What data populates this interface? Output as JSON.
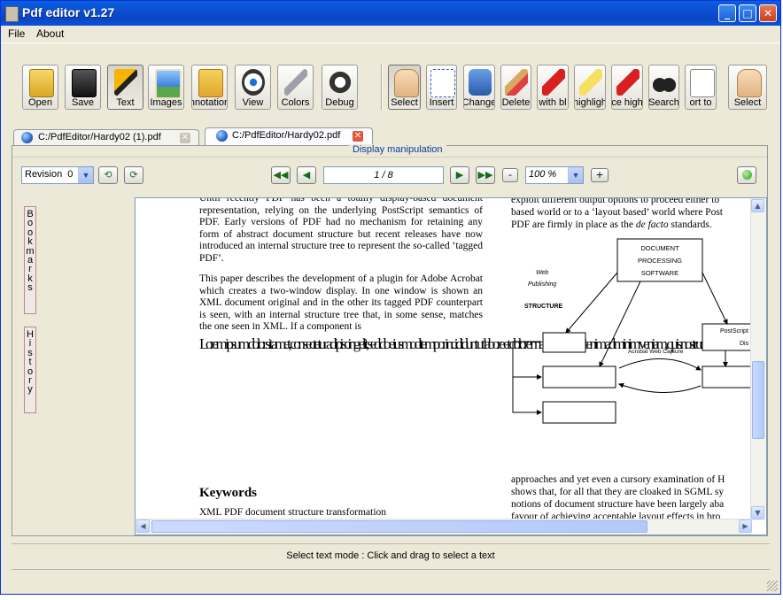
{
  "window": {
    "title": "Pdf editor v1.27"
  },
  "menu": [
    "File",
    "About"
  ],
  "toolbar": {
    "left": [
      {
        "label": "Open",
        "icon": "folder-icon"
      },
      {
        "label": "Save",
        "icon": "floppy-disk-icon"
      },
      {
        "label": "Text",
        "icon": "marker-pen-icon"
      },
      {
        "label": "Images",
        "icon": "picture-icon"
      },
      {
        "label": "nnotation",
        "icon": "sticky-note-icon"
      },
      {
        "label": "View",
        "icon": "eye-icon"
      },
      {
        "label": "Colors",
        "icon": "wrench-icon"
      },
      {
        "label": "Debug",
        "icon": "bug-icon"
      }
    ],
    "right": [
      {
        "label": "Select",
        "icon": "hand-icon"
      },
      {
        "label": "Insert",
        "icon": "insert-text-icon"
      },
      {
        "label": "Change",
        "icon": "paint-bucket-icon"
      },
      {
        "label": "Delete",
        "icon": "broom-delete-icon"
      },
      {
        "label": "with bl",
        "icon": "red-marker-icon"
      },
      {
        "label": "highligh",
        "icon": "highlighter-icon"
      },
      {
        "label": "ce high",
        "icon": "red-marker-icon"
      },
      {
        "label": "Search",
        "icon": "binoculars-icon"
      },
      {
        "label": "ort to",
        "icon": "export-icon"
      },
      {
        "label": "Select",
        "icon": "hand-icon"
      }
    ]
  },
  "tabs": [
    {
      "label": "C:/PdfEditor/Hardy02 (1).pdf",
      "active": false
    },
    {
      "label": "C:/PdfEditor/Hardy02.pdf",
      "active": true
    }
  ],
  "display": {
    "section_title": "Display manipulation",
    "revision": "Revision  0",
    "page": "1 / 8",
    "zoom": "100 %",
    "minus": "-",
    "plus": "+"
  },
  "sidebar": {
    "bookmarks": "Bookmarks",
    "history": "History"
  },
  "document": {
    "left_p1": "Until recently PDF has been a totally display-based document representation, relying on the underlying PostScript semantics of PDF. Early versions of PDF had no mechanism for retaining any form of abstract document structure but recent releases have now introduced an internal structure tree to represent the so-called ‘tagged PDF’.",
    "left_p2": "This paper describes the development of a plugin for Adobe Acrobat which creates a two-window display. In one window is shown an XML document original and in the other its tagged PDF counterpart is seen, with an internal structure tree that, in some sense, matches the one seen in XML. If a component is",
    "overlay": "Lorem ipsum dolor sit amet, consectetur adipiscing elit, sed do eiusmod tempor incididunt ut labore et dolore magna aliqua. Ut enim ad minim veniam, quis nostrud exercitation ullamco",
    "right_top_l1": "exploit different output options to proceed either to",
    "right_top_l2": "based world or to a ‘layout based’ world where Post",
    "right_top_l3_a": "PDF are firmly in place as the ",
    "right_top_l3_b": "de facto",
    "right_top_l3_c": " standards.",
    "diagram": {
      "box_main_1": "DOCUMENT",
      "box_main_2": "PROCESSING",
      "box_main_3": "SOFTWARE",
      "web_1": "Web",
      "web_2": "Publishing",
      "structure": "STRUCTURE",
      "postscript": "PostScript",
      "acrobat": "Acrobat Web Capture",
      "dis": "Dis"
    },
    "right_bot_l1": "approaches and yet even a cursory examination of H",
    "right_bot_l2": "shows that, for all that they are cloaked in SGML sy",
    "right_bot_l3": "notions of document structure have been largely aba",
    "right_bot_l4": "favour of achieving acceptable layout effects in bro",
    "keywords_title": "Keywords",
    "keywords": "XML PDF document structure transformation"
  },
  "status": "Select text mode : Click and drag to select a text"
}
